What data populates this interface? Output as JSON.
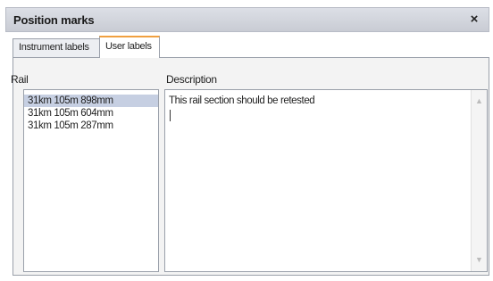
{
  "window": {
    "title": "Position marks",
    "close_glyph": "×"
  },
  "tabs": [
    {
      "label": "Instrument labels",
      "active": false
    },
    {
      "label": "User labels",
      "active": true
    }
  ],
  "rail": {
    "label": "Rail",
    "items": [
      {
        "text": "31km 105m 898mm",
        "selected": true
      },
      {
        "text": "31km 105m 604mm",
        "selected": false
      },
      {
        "text": "31km 105m 287mm",
        "selected": false
      }
    ]
  },
  "description": {
    "label": "Description",
    "value": "This rail section should be retested"
  },
  "icons": {
    "close": "close-icon",
    "scroll_up": "chevron-up-icon",
    "scroll_down": "chevron-down-icon"
  }
}
